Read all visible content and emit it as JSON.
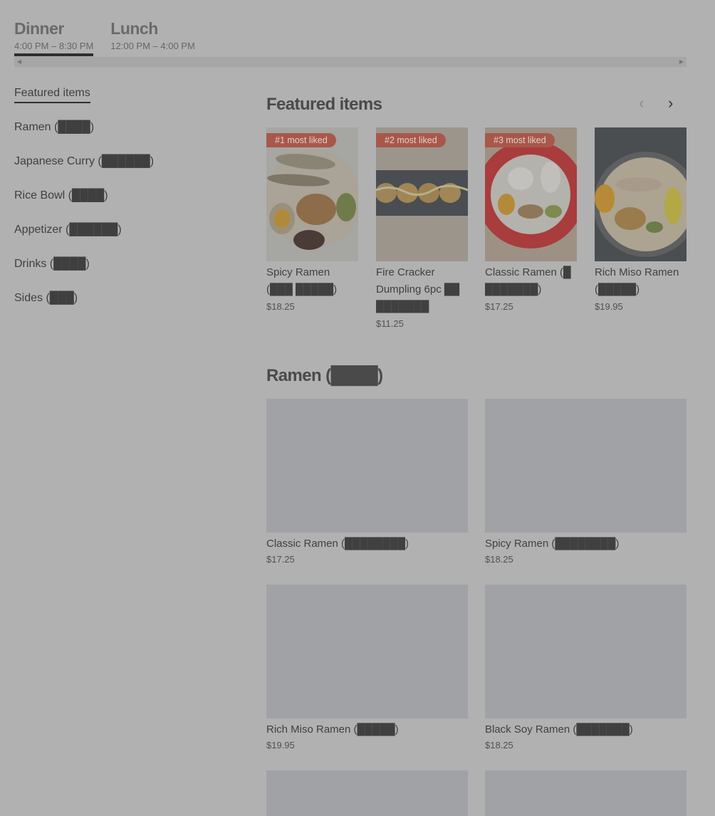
{
  "menus": [
    {
      "title": "Dinner",
      "hours": "4:00 PM – 8:30 PM",
      "active": true
    },
    {
      "title": "Lunch",
      "hours": "12:00 PM – 4:00 PM",
      "active": false
    }
  ],
  "categories": [
    {
      "label": "Featured items"
    },
    {
      "label": "Ramen (████)"
    },
    {
      "label": "Japanese Curry (██████)"
    },
    {
      "label": "Rice Bowl (████)"
    },
    {
      "label": "Appetizer (██████)"
    },
    {
      "label": "Drinks (████)"
    },
    {
      "label": "Sides (███)"
    }
  ],
  "featured": {
    "title": "Featured items",
    "prev_icon": "chevron-left-icon",
    "next_icon": "chevron-right-icon",
    "items": [
      {
        "badge": "#1 most liked",
        "name": "Spicy Ramen (███ █████)",
        "price": "$18.25"
      },
      {
        "badge": "#2 most liked",
        "name": "Fire Cracker Dumpling 6pc ██ ███████",
        "price": "$11.25"
      },
      {
        "badge": "#3 most liked",
        "name": "Classic Ramen (█ ███████)",
        "price": "$17.25"
      },
      {
        "badge": "",
        "name": "Rich Miso Ramen (█████)",
        "price": "$19.95"
      }
    ]
  },
  "ramen": {
    "title": "Ramen (████)",
    "items": [
      {
        "name": "Classic Ramen (████████)",
        "price": "$17.25"
      },
      {
        "name": "Spicy Ramen (████████)",
        "price": "$18.25"
      },
      {
        "name": "Rich Miso Ramen (█████)",
        "price": "$19.95"
      },
      {
        "name": "Black Soy Ramen (███████)",
        "price": "$18.25"
      }
    ]
  },
  "colors": {
    "background": "#b1b1b1",
    "badge": "#a8584a",
    "placeholder": "#a0a2a6"
  }
}
